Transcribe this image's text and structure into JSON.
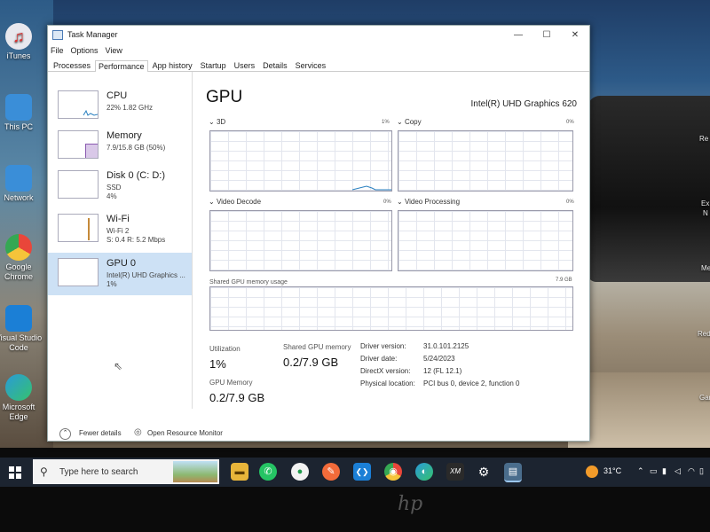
{
  "desktop": {
    "icons": [
      {
        "label": "iTunes",
        "icon": "itunes-icon",
        "color": "#e8e8ee"
      },
      {
        "label": "This PC",
        "icon": "computer-icon",
        "color": "#3a8ed8"
      },
      {
        "label": "Network",
        "icon": "network-icon",
        "color": "#3a8ed8"
      },
      {
        "label": "Google Chrome",
        "icon": "chrome-icon",
        "color": "#e9463a"
      },
      {
        "label": "Visual Studio Code",
        "icon": "vscode-icon",
        "color": "#1b7fd6"
      },
      {
        "label": "Microsoft Edge",
        "icon": "edge-icon",
        "color": "#2a9ad8"
      }
    ],
    "edge_fragments": [
      "Re",
      "Ex",
      "N",
      "Me",
      "Redi",
      "Gar"
    ]
  },
  "window": {
    "title": "Task Manager",
    "controls": {
      "minimize": "—",
      "maximize": "☐",
      "close": "✕"
    },
    "menu": [
      "File",
      "Options",
      "View"
    ],
    "tabs": [
      "Processes",
      "Performance",
      "App history",
      "Startup",
      "Users",
      "Details",
      "Services"
    ],
    "active_tab": "Performance"
  },
  "sidebar": {
    "items": [
      {
        "name": "CPU",
        "line2": "22%  1.82 GHz",
        "line3": ""
      },
      {
        "name": "Memory",
        "line2": "7.9/15.8 GB (50%)",
        "line3": ""
      },
      {
        "name": "Disk 0 (C: D:)",
        "line2": "SSD",
        "line3": "4%"
      },
      {
        "name": "Wi-Fi",
        "line2": "Wi-Fi 2",
        "line3": "S: 0.4  R: 5.2 Mbps"
      },
      {
        "name": "GPU 0",
        "line2": "Intel(R) UHD Graphics ...",
        "line3": "1%"
      }
    ],
    "selected": "GPU 0"
  },
  "gpu": {
    "title": "GPU",
    "model": "Intel(R) UHD Graphics 620",
    "panels": [
      {
        "label": "3D",
        "pct": "1%"
      },
      {
        "label": "Copy",
        "pct": "0%"
      },
      {
        "label": "Video Decode",
        "pct": "0%"
      },
      {
        "label": "Video Processing",
        "pct": "0%"
      }
    ],
    "shared_memory": {
      "label": "Shared GPU memory usage",
      "max": "7.9 GB"
    },
    "stats": {
      "utilization_label": "Utilization",
      "utilization_value": "1%",
      "shared_label": "Shared GPU memory",
      "shared_value": "0.2/7.9 GB",
      "gpu_memory_label": "GPU Memory",
      "gpu_memory_value": "0.2/7.9 GB"
    },
    "details": [
      {
        "key": "Driver version:",
        "value": "31.0.101.2125"
      },
      {
        "key": "Driver date:",
        "value": "5/24/2023"
      },
      {
        "key": "DirectX version:",
        "value": "12 (FL 12.1)"
      },
      {
        "key": "Physical location:",
        "value": "PCI bus 0, device 2, function 0"
      }
    ]
  },
  "footer": {
    "fewer_details": "Fewer details",
    "open_monitor": "Open Resource Monitor"
  },
  "taskbar": {
    "search_placeholder": "Type here to search",
    "apps": [
      {
        "icon": "file-explorer-icon",
        "color": "#e8b53a",
        "glyph": "▬"
      },
      {
        "icon": "whatsapp-icon",
        "color": "#25c464",
        "glyph": "✆"
      },
      {
        "icon": "mongodb-compass-icon",
        "color": "#f2f2f2",
        "glyph": "●"
      },
      {
        "icon": "postman-icon",
        "color": "#f26b3a",
        "glyph": "✎"
      },
      {
        "icon": "vscode-icon",
        "color": "#1b7fd6",
        "glyph": "❮❯"
      },
      {
        "icon": "chrome-icon",
        "color": "#e9463a",
        "glyph": "◉"
      },
      {
        "icon": "edge-icon",
        "color": "#2a9ad8",
        "glyph": "◐"
      },
      {
        "icon": "xampp-icon",
        "color": "#2a2a2a",
        "glyph": "XM"
      },
      {
        "icon": "settings-icon",
        "color": "#2a2a2a",
        "glyph": "⚙"
      },
      {
        "icon": "task-manager-icon",
        "color": "#4a6d8c",
        "glyph": "▤"
      }
    ],
    "weather": "31°C",
    "accent": "#1c2430"
  }
}
